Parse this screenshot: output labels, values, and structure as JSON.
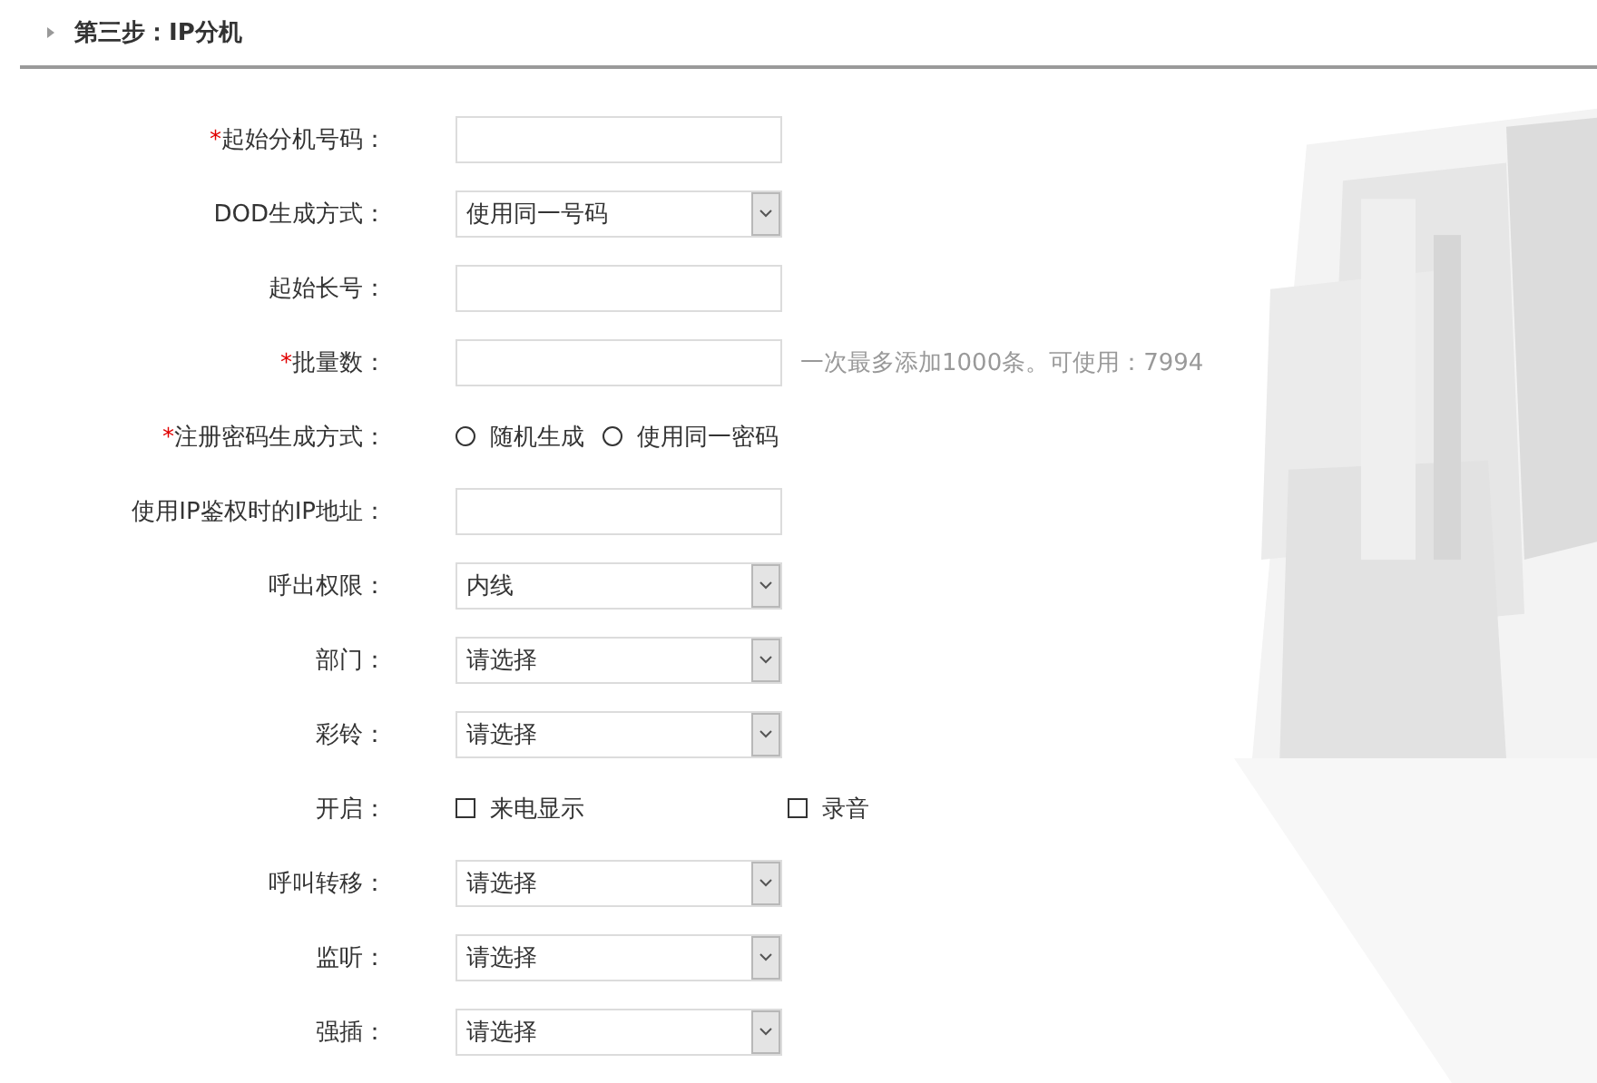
{
  "section": {
    "title": "第三步：IP分机",
    "expanded": false
  },
  "rows": [
    {
      "kind": "text",
      "required_mark": "*",
      "label": "起始分机号码："
    },
    {
      "kind": "select",
      "label": "DOD生成方式：",
      "value": "使用同一号码"
    },
    {
      "kind": "text",
      "label": "起始长号："
    },
    {
      "kind": "text",
      "required_mark": "*",
      "label": "批量数：",
      "hint": "一次最多添加1000条。可使用：7994"
    },
    {
      "kind": "radio",
      "required_mark": "*",
      "label": "注册密码生成方式：",
      "options": [
        {
          "label": "随机生成",
          "selected": false
        },
        {
          "label": "使用同一密码",
          "selected": false
        }
      ]
    },
    {
      "kind": "text",
      "label": "使用IP鉴权时的IP地址："
    },
    {
      "kind": "select",
      "label": "呼出权限：",
      "value": "内线"
    },
    {
      "kind": "select",
      "label": "部门：",
      "value": "请选择"
    },
    {
      "kind": "select",
      "label": "彩铃：",
      "value": "请选择"
    },
    {
      "kind": "checkbox",
      "label": "开启：",
      "options": [
        {
          "label": "来电显示",
          "checked": false
        },
        {
          "label": "录音",
          "checked": false
        }
      ]
    },
    {
      "kind": "select",
      "label": "呼叫转移：",
      "value": "请选择"
    },
    {
      "kind": "select",
      "label": "监听：",
      "value": "请选择"
    },
    {
      "kind": "select",
      "label": "强插：",
      "value": "请选择"
    }
  ]
}
